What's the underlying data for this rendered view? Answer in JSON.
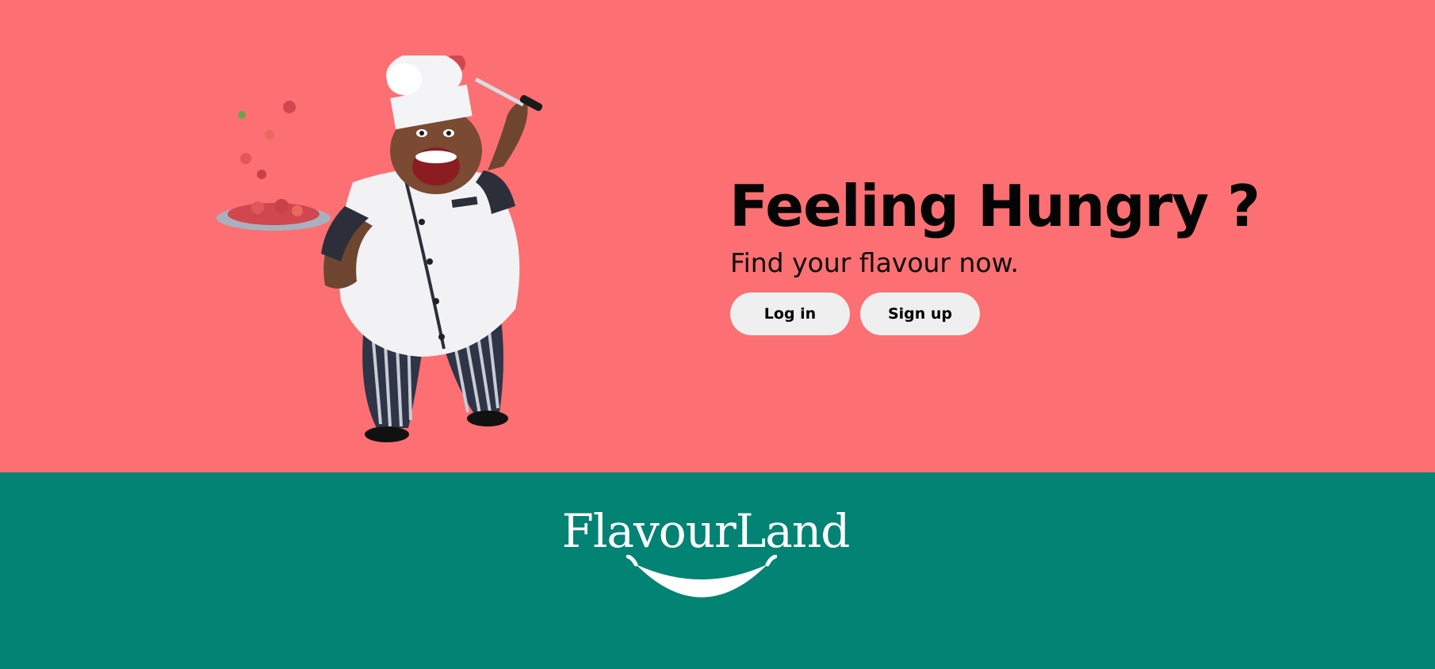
{
  "hero": {
    "headline": "Feeling Hungry ?",
    "subheadline": "Find your flavour now.",
    "login_label": "Log in",
    "signup_label": "Sign up",
    "illustration": "chef-icon"
  },
  "footer": {
    "logo_text": "FlavourLand",
    "logo_mark": "smile-icon"
  },
  "colors": {
    "hero_background": "#fc6f72",
    "footer_background": "#028374",
    "button_background": "#efefef",
    "logo_color": "#ffffff"
  }
}
